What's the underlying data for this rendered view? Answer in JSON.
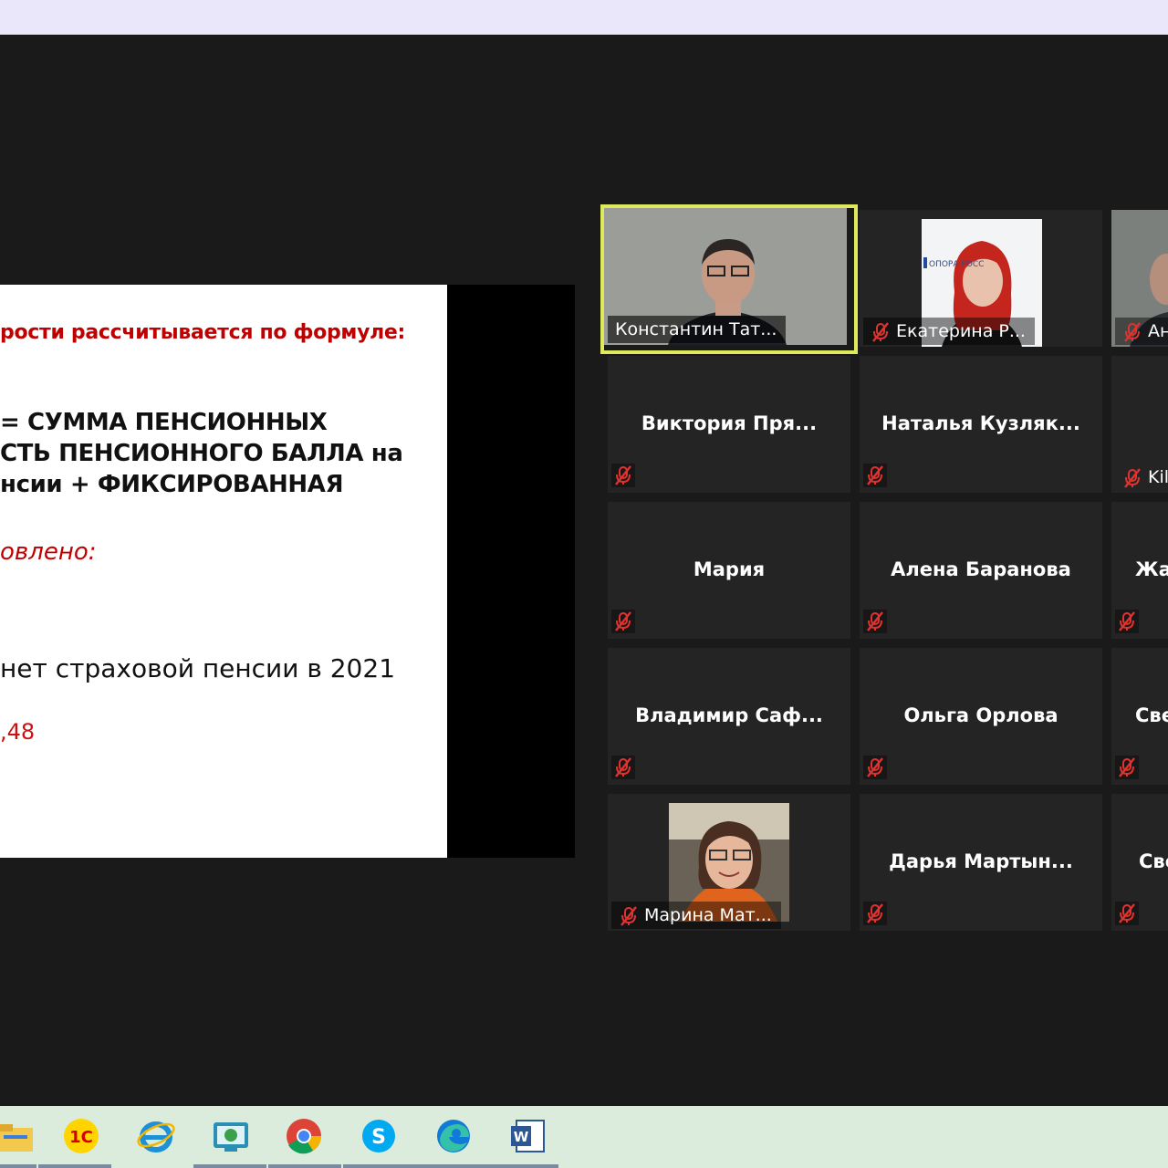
{
  "slide": {
    "line1": "рости рассчитывается по формуле:",
    "line2": "= СУММА ПЕНСИОННЫХ",
    "line3": "СТЬ ПЕНСИОННОГО БАЛЛА на",
    "line4": "нсии + ФИКСИРОВАННАЯ",
    "line5": "овлено:",
    "line6": "нет страховой пенсии в 2021",
    "line7": ",48"
  },
  "participants": [
    {
      "name": "Константин Тат...",
      "video": true,
      "muted": false,
      "active": true
    },
    {
      "name": "Екатерина Р...",
      "video": true,
      "muted": true
    },
    {
      "name": "Ан",
      "video": true,
      "muted": true
    },
    {
      "name": "Виктория  Пря...",
      "video": false,
      "muted": true
    },
    {
      "name": "Наталья  Кузляк...",
      "video": false,
      "muted": true
    },
    {
      "name": "Kil",
      "video": false,
      "muted": true
    },
    {
      "name": "Мария",
      "video": false,
      "muted": true
    },
    {
      "name": "Алена Баранова",
      "video": false,
      "muted": true
    },
    {
      "name": "Жа",
      "video": false,
      "muted": true
    },
    {
      "name": "Владимир  Саф...",
      "video": false,
      "muted": true
    },
    {
      "name": "Ольга Орлова",
      "video": false,
      "muted": true
    },
    {
      "name": "Све",
      "video": false,
      "muted": true
    },
    {
      "name": "Марина Мат...",
      "video": true,
      "muted": true
    },
    {
      "name": "Дарья  Мартын...",
      "video": false,
      "muted": true
    },
    {
      "name": "Све",
      "video": false,
      "muted": true
    }
  ],
  "background_text": {
    "opora_logo": "ОПОРА РОСС"
  },
  "taskbar": {
    "icons": [
      "file-explorer-icon",
      "1c-icon",
      "internet-explorer-icon",
      "remote-desktop-icon",
      "chrome-icon",
      "skype-icon",
      "edge-icon",
      "word-icon"
    ],
    "labels": {
      "onec": "1С",
      "skype": "S",
      "word": "W"
    }
  },
  "colors": {
    "active_speaker_border": "#dfe95c",
    "muted_icon": "#e0322f",
    "slide_red": "#c00000",
    "tile_bg": "#242424"
  }
}
